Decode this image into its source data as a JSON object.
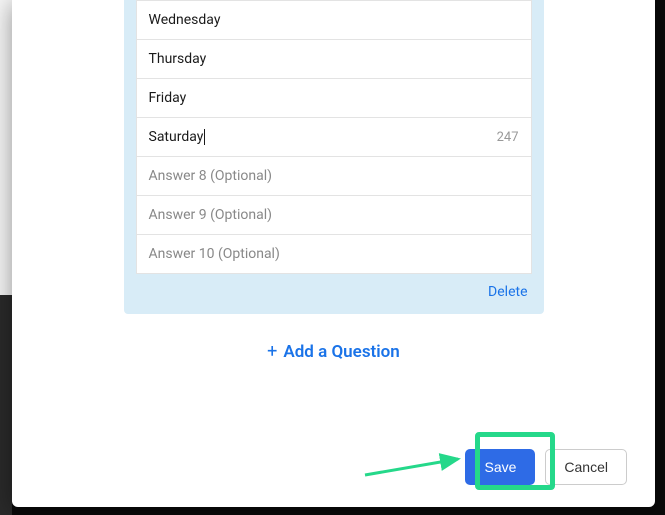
{
  "answers": [
    {
      "text": "Wednesday",
      "placeholder": false,
      "active": false,
      "count": null
    },
    {
      "text": "Thursday",
      "placeholder": false,
      "active": false,
      "count": null
    },
    {
      "text": "Friday",
      "placeholder": false,
      "active": false,
      "count": null
    },
    {
      "text": "Saturday",
      "placeholder": false,
      "active": true,
      "count": "247"
    },
    {
      "text": "Answer 8 (Optional)",
      "placeholder": true,
      "active": false,
      "count": null
    },
    {
      "text": "Answer 9 (Optional)",
      "placeholder": true,
      "active": false,
      "count": null
    },
    {
      "text": "Answer 10 (Optional)",
      "placeholder": true,
      "active": false,
      "count": null
    }
  ],
  "delete_label": "Delete",
  "add_question_label": "Add a Question",
  "save_label": "Save",
  "cancel_label": "Cancel",
  "colors": {
    "accent": "#1a73e8",
    "primary_btn": "#2e6be6",
    "highlight": "#25d88a"
  }
}
